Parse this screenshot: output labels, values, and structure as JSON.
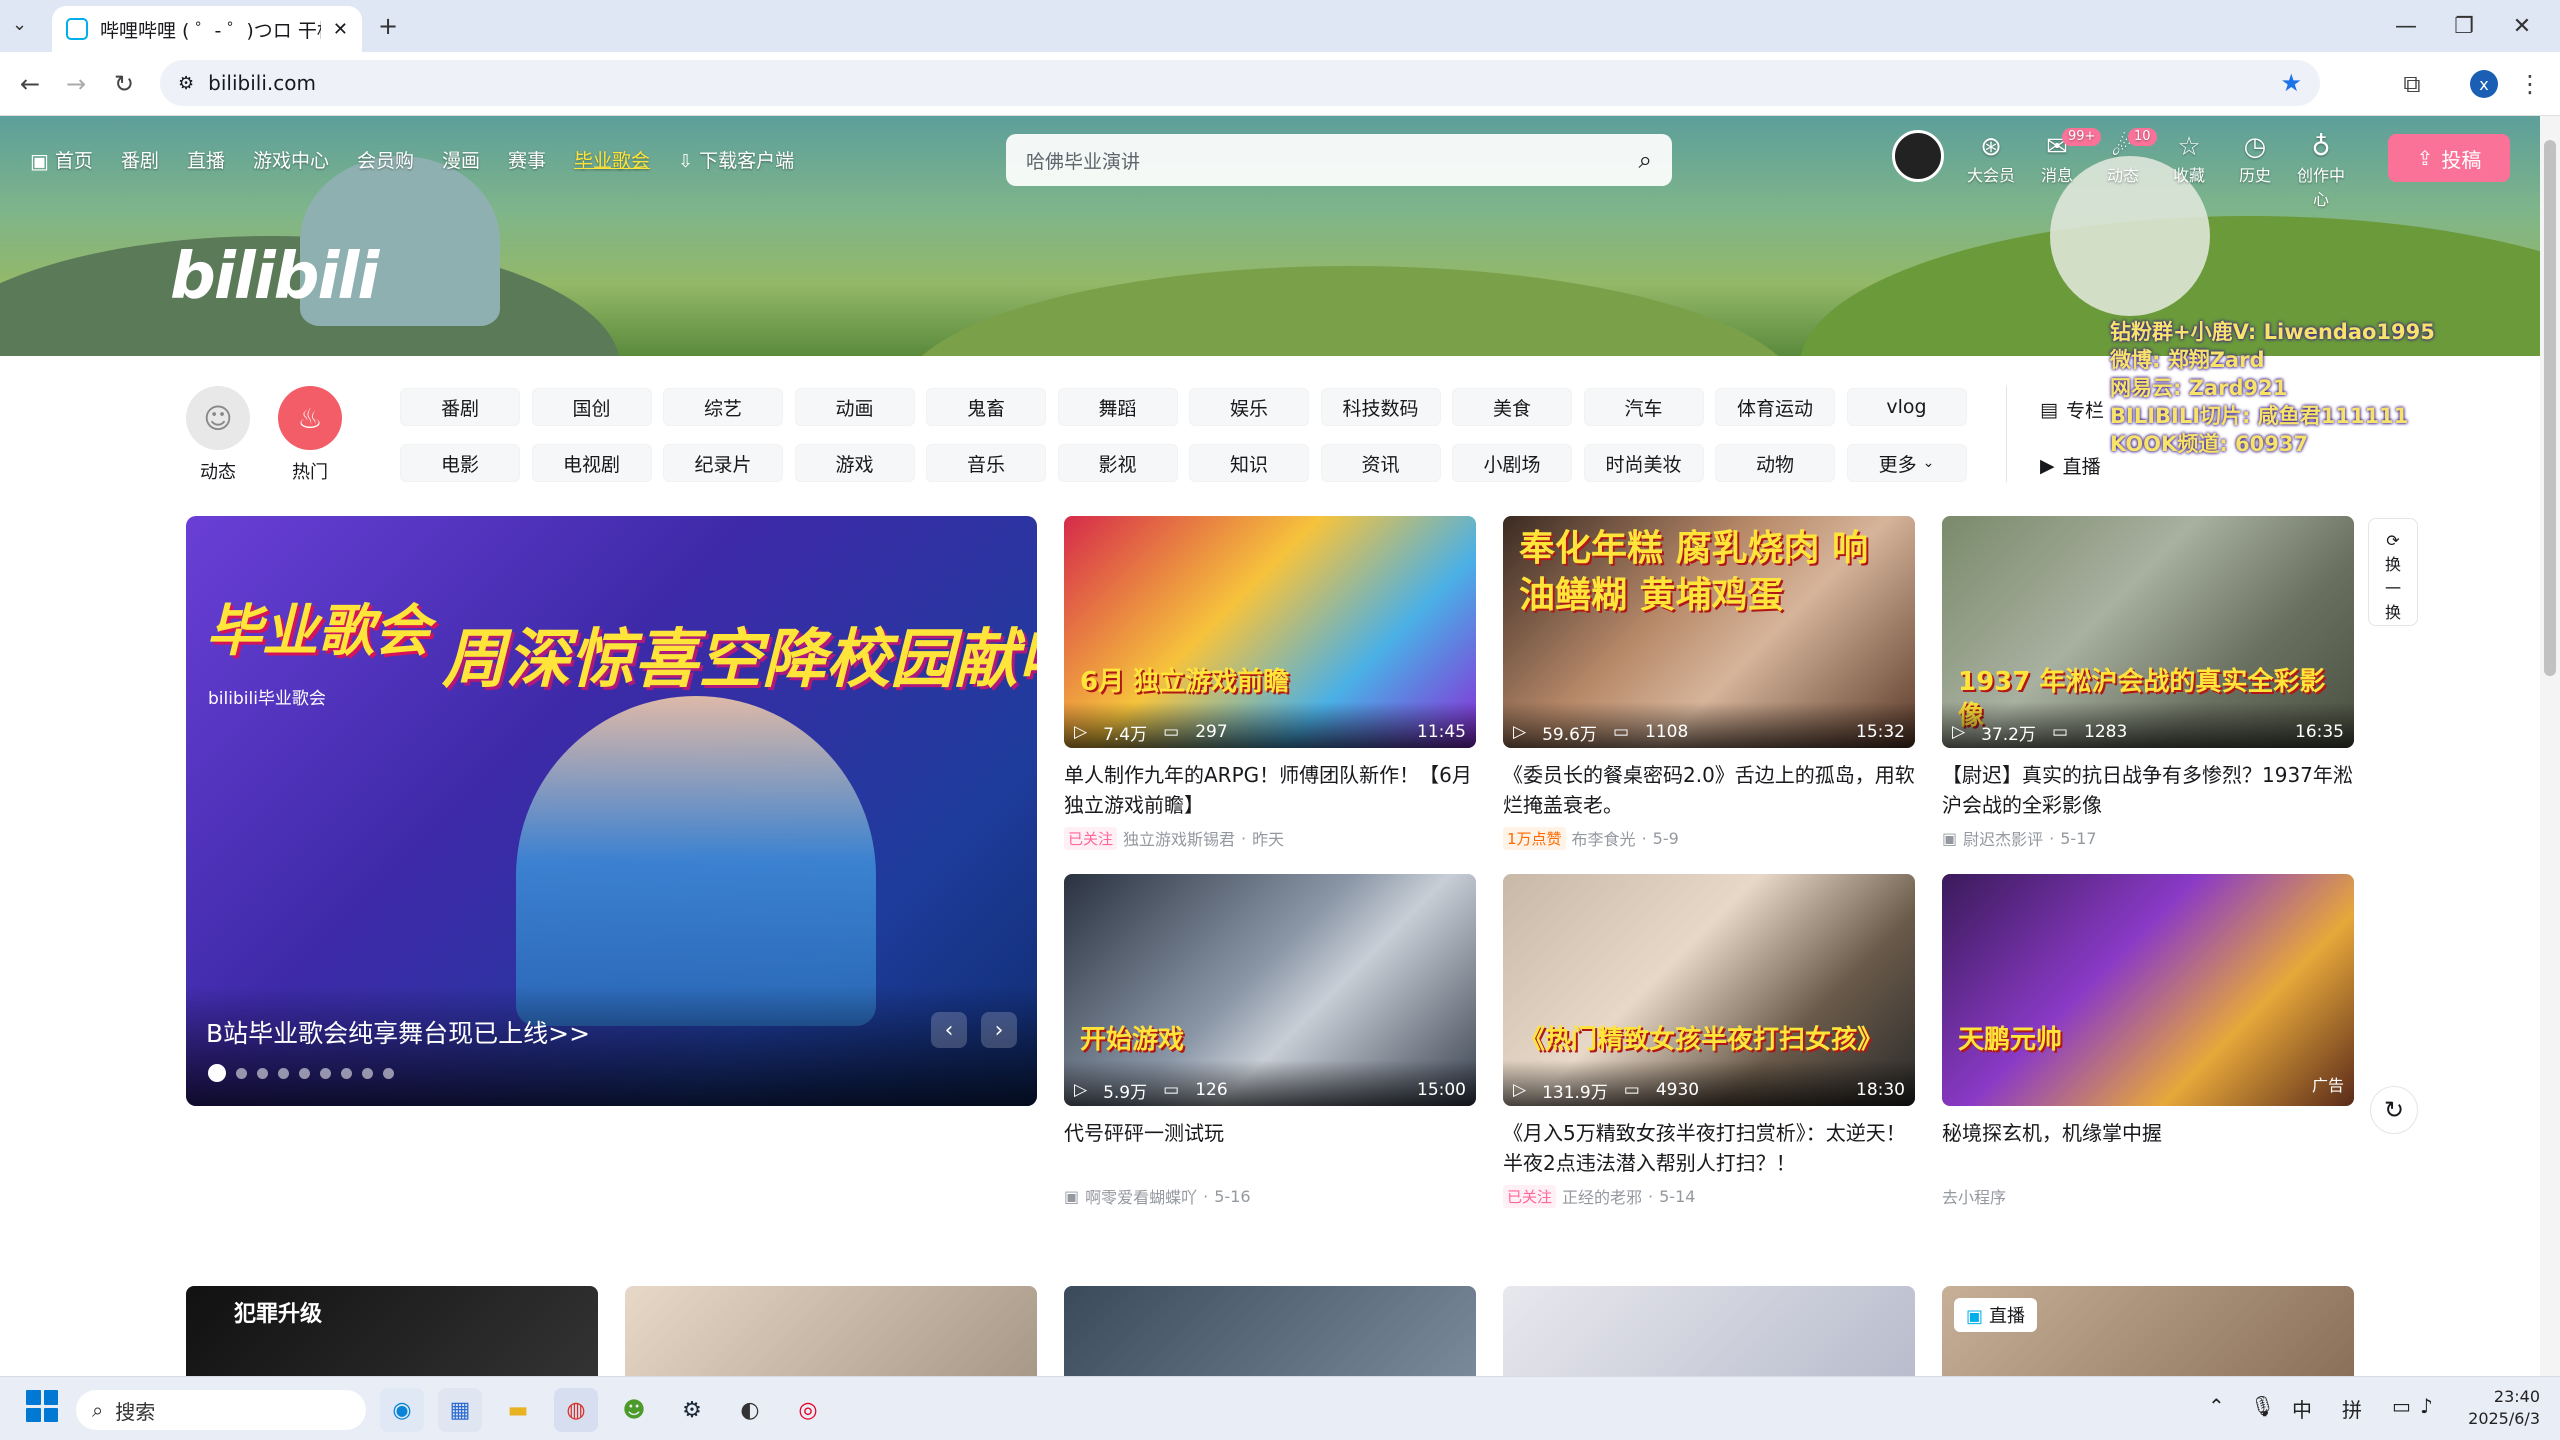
{
  "browser": {
    "tab_title": "哔哩哔哩 ( ゜- ゜)つロ 干杯~-bilibili",
    "url": "bilibili.com",
    "profile_initial": "x"
  },
  "header": {
    "nav": [
      "首页",
      "番剧",
      "直播",
      "游戏中心",
      "会员购",
      "漫画",
      "赛事",
      "毕业歌会",
      "下载客户端"
    ],
    "logo": "bilibili",
    "search_placeholder": "哈佛毕业演讲",
    "right_items": [
      {
        "label": "大会员",
        "icon": "vip-icon",
        "glyph": "⊛"
      },
      {
        "label": "消息",
        "icon": "message-icon",
        "glyph": "✉",
        "badge": "99+"
      },
      {
        "label": "动态",
        "icon": "dynamic-icon",
        "glyph": "☄",
        "badge": "10"
      },
      {
        "label": "收藏",
        "icon": "star-icon",
        "glyph": "☆"
      },
      {
        "label": "历史",
        "icon": "history-icon",
        "glyph": "◷"
      },
      {
        "label": "创作中心",
        "icon": "bulb-icon",
        "glyph": "♁"
      }
    ],
    "upload_label": "投稿"
  },
  "overlay_lines": [
    "钻粉群+小鹿V: Liwendao1995",
    "微博: 郑翔Zard",
    "网易云: Zard921",
    "BILIBILI切片: 咸鱼君111111",
    "KOOK频道: 60937"
  ],
  "channels": {
    "big": [
      {
        "label": "动态",
        "color": "#e8e8e8"
      },
      {
        "label": "热门",
        "color": "#f25d67"
      }
    ],
    "row1": [
      "番剧",
      "国创",
      "综艺",
      "动画",
      "鬼畜",
      "舞蹈",
      "娱乐",
      "科技数码",
      "美食",
      "汽车",
      "体育运动",
      "vlog"
    ],
    "row2": [
      "电影",
      "电视剧",
      "纪录片",
      "游戏",
      "音乐",
      "影视",
      "知识",
      "资讯",
      "小剧场",
      "时尚美妆",
      "动物",
      "更多"
    ],
    "side": [
      {
        "label": "专栏",
        "icon": "article-icon",
        "glyph": "▤"
      },
      {
        "label": "直播",
        "icon": "live-icon",
        "glyph": "▶"
      }
    ]
  },
  "carousel": {
    "headline": "周深惊喜空降校园献唱",
    "tag": "毕业歌会",
    "subtag": "bilibili毕业歌会",
    "caption": "B站毕业歌会纯享舞台现已上线>>",
    "dot_count": 9
  },
  "videos": [
    {
      "views": "7.4万",
      "danmaku": "297",
      "duration": "11:45",
      "title": "单人制作九年的ARPG！师傅团队新作！【6月独立游戏前瞻】",
      "tag": "已关注",
      "tag_type": "f",
      "author": "独立游戏斯锡君",
      "date": "昨天",
      "thumb_text": "6月 独立游戏前瞻",
      "bg": "linear-gradient(135deg,#d62a4a,#f6c33c 40%,#4ab0e6 70%,#8a2ad6)"
    },
    {
      "views": "59.6万",
      "danmaku": "1108",
      "duration": "15:32",
      "title": "《委员长的餐桌密码2.0》舌边上的孤岛，用软烂掩盖衰老。",
      "tag": "1万点赞",
      "tag_type": "h",
      "author": "布李食光",
      "date": "5-9",
      "thumb_text": "奉化年糕 腐乳烧肉 响油鳝糊 黄埔鸡蛋",
      "bg": "linear-gradient(135deg,#3a2a22,#b88a6a 40%,#d6b49a 60%,#5a3a2a)"
    },
    {
      "views": "37.2万",
      "danmaku": "1283",
      "duration": "16:35",
      "title": "【尉迟】真实的抗日战争有多惨烈？1937年淞沪会战的全彩影像",
      "tag": "",
      "tag_type": "",
      "author": "尉迟杰影评",
      "date": "5-17",
      "thumb_text": "1937 年淞沪会战的真实全彩影像",
      "bg": "linear-gradient(135deg,#7a8a6a,#a8b0a0 40%,#6a7060 70%,#4a5040)"
    },
    {
      "views": "5.9万",
      "danmaku": "126",
      "duration": "15:00",
      "title": "代号砰砰一测试玩",
      "tag": "",
      "tag_type": "",
      "author": "啊零爱看蝴蝶吖",
      "date": "5-16",
      "thumb_text": "开始游戏",
      "bg": "linear-gradient(135deg,#2a3240,#8a96a6 45%,#c8ced6 60%,#3a4250)"
    },
    {
      "views": "131.9万",
      "danmaku": "4930",
      "duration": "18:30",
      "title": "《月入5万精致女孩半夜打扫赏析》：太逆天！半夜2点违法潜入帮别人打扫？！",
      "tag": "已关注",
      "tag_type": "f",
      "author": "正经的老邪",
      "date": "5-14",
      "thumb_text": "《热门精致女孩半夜打扫女孩》",
      "bg": "linear-gradient(135deg,#c8b8a8,#e8d8c8 40%,#6a5a4a 70%,#2a2a2a)"
    },
    {
      "views": "",
      "danmaku": "",
      "duration": "",
      "title": "秘境探玄机，机缘掌中握",
      "tag": "",
      "tag_type": "",
      "author": "去小程序",
      "date": "",
      "thumb_text": "天鹏元帅",
      "bg": "linear-gradient(135deg,#3a1a5a,#8a3ac6 40%,#e6a83a 70%,#5a2a1a)",
      "ad": "广告"
    }
  ],
  "refresh_label": [
    "换",
    "一",
    "换"
  ],
  "bottom_row": [
    {
      "label": "犯罪升级",
      "bg": "linear-gradient(135deg,#111,#333)"
    },
    {
      "label": "",
      "bg": "linear-gradient(135deg,#e8d8c8,#a89888)"
    },
    {
      "label": "",
      "bg": "linear-gradient(135deg,#3a4a5a,#7a8a9a)"
    },
    {
      "label": "",
      "bg": "linear-gradient(135deg,#e8e8ee,#b8bccc)"
    },
    {
      "label": "直播",
      "bg": "linear-gradient(135deg,#c8b098,#8a7058)"
    }
  ],
  "taskbar": {
    "search": "搜索",
    "tray": [
      "中",
      "拼"
    ],
    "time": "23:40",
    "date": "2025/6/3"
  }
}
